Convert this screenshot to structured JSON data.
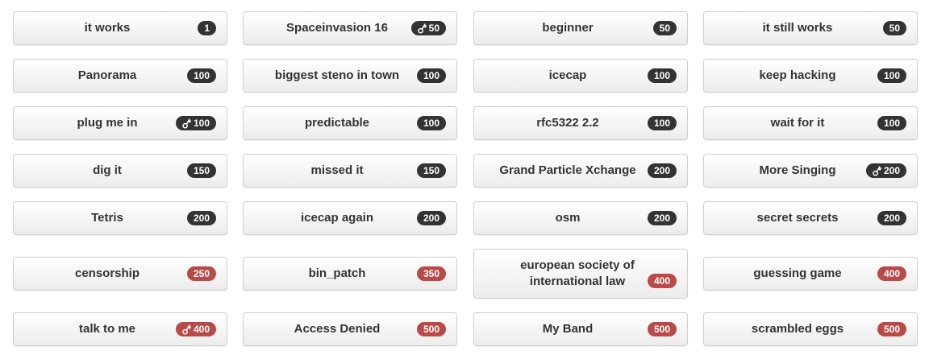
{
  "colors": {
    "badge_default": "#333333",
    "badge_high": "#b94a48"
  },
  "challenges": [
    {
      "title": "it works",
      "points": "1",
      "key": false,
      "tone": "default"
    },
    {
      "title": "Spaceinvasion 16",
      "points": "50",
      "key": true,
      "tone": "default"
    },
    {
      "title": "beginner",
      "points": "50",
      "key": false,
      "tone": "default"
    },
    {
      "title": "it still works",
      "points": "50",
      "key": false,
      "tone": "default"
    },
    {
      "title": "Panorama",
      "points": "100",
      "key": false,
      "tone": "default"
    },
    {
      "title": "biggest steno in town",
      "points": "100",
      "key": false,
      "tone": "default"
    },
    {
      "title": "icecap",
      "points": "100",
      "key": false,
      "tone": "default"
    },
    {
      "title": "keep hacking",
      "points": "100",
      "key": false,
      "tone": "default"
    },
    {
      "title": "plug me in",
      "points": "100",
      "key": true,
      "tone": "default"
    },
    {
      "title": "predictable",
      "points": "100",
      "key": false,
      "tone": "default"
    },
    {
      "title": "rfc5322 2.2",
      "points": "100",
      "key": false,
      "tone": "default"
    },
    {
      "title": "wait for it",
      "points": "100",
      "key": false,
      "tone": "default"
    },
    {
      "title": "dig it",
      "points": "150",
      "key": false,
      "tone": "default"
    },
    {
      "title": "missed it",
      "points": "150",
      "key": false,
      "tone": "default"
    },
    {
      "title": "Grand Particle Xchange",
      "points": "200",
      "key": false,
      "tone": "default"
    },
    {
      "title": "More Singing",
      "points": "200",
      "key": true,
      "tone": "default"
    },
    {
      "title": "Tetris",
      "points": "200",
      "key": false,
      "tone": "default"
    },
    {
      "title": "icecap again",
      "points": "200",
      "key": false,
      "tone": "default"
    },
    {
      "title": "osm",
      "points": "200",
      "key": false,
      "tone": "default"
    },
    {
      "title": "secret secrets",
      "points": "200",
      "key": false,
      "tone": "default"
    },
    {
      "title": "censorship",
      "points": "250",
      "key": false,
      "tone": "high"
    },
    {
      "title": "bin_patch",
      "points": "350",
      "key": false,
      "tone": "high"
    },
    {
      "title": "european society of international law",
      "points": "400",
      "key": false,
      "tone": "high"
    },
    {
      "title": "guessing game",
      "points": "400",
      "key": false,
      "tone": "high"
    },
    {
      "title": "talk to me",
      "points": "400",
      "key": true,
      "tone": "high"
    },
    {
      "title": "Access Denied",
      "points": "500",
      "key": false,
      "tone": "high"
    },
    {
      "title": "My Band",
      "points": "500",
      "key": false,
      "tone": "high"
    },
    {
      "title": "scrambled eggs",
      "points": "500",
      "key": false,
      "tone": "high"
    }
  ]
}
